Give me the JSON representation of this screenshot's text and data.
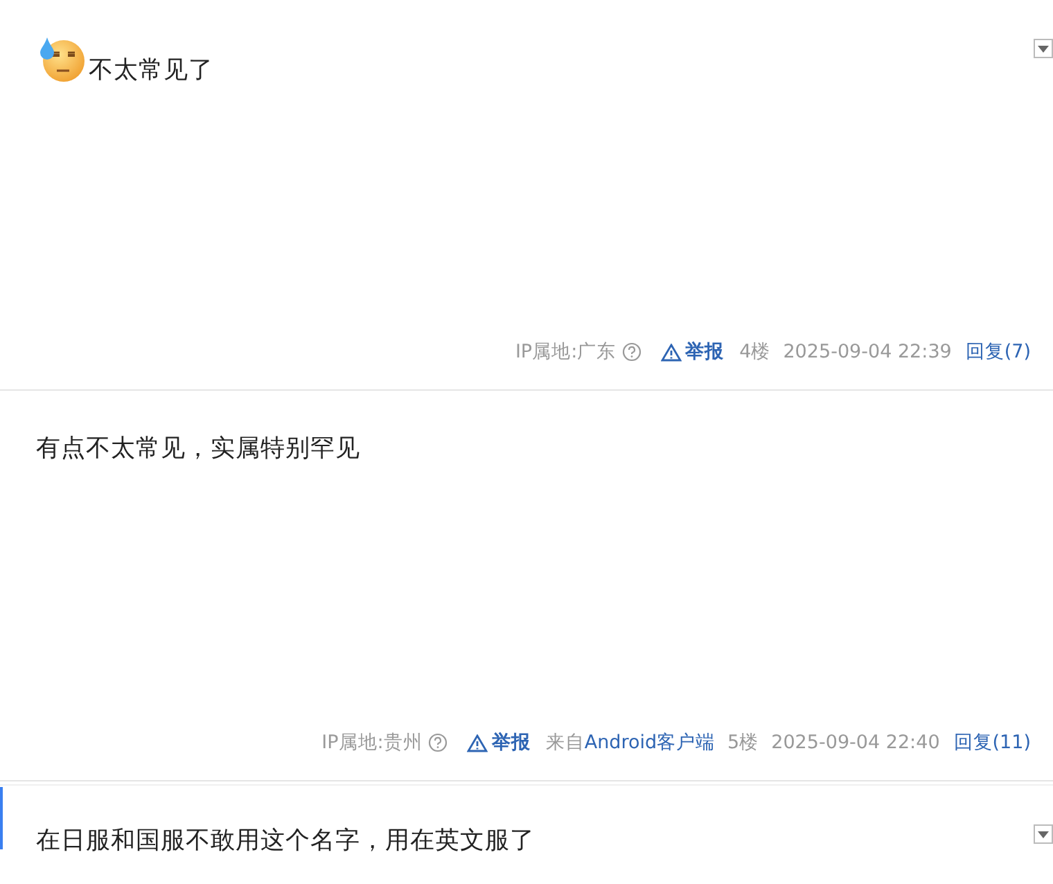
{
  "posts": [
    {
      "selected": false,
      "emoji": true,
      "content": "不太常见了",
      "menu": true,
      "footer": {
        "ip": "IP属地:广东",
        "report": "举报",
        "floor": "4楼",
        "time": "2025-09-04 22:39",
        "reply": "回复(7)"
      }
    },
    {
      "selected": false,
      "emoji": false,
      "content": "有点不太常见，实属特别罕见",
      "menu": false,
      "footer": {
        "ip": "IP属地:贵州",
        "report": "举报",
        "source": {
          "prefix": "来自",
          "link": "Android客户端"
        },
        "floor": "5楼",
        "time": "2025-09-04 22:40",
        "reply": "回复(11)"
      }
    },
    {
      "selected": true,
      "emoji": false,
      "content": "在日服和国服不敢用这个名字，用在英文服了",
      "menu": true
    }
  ]
}
